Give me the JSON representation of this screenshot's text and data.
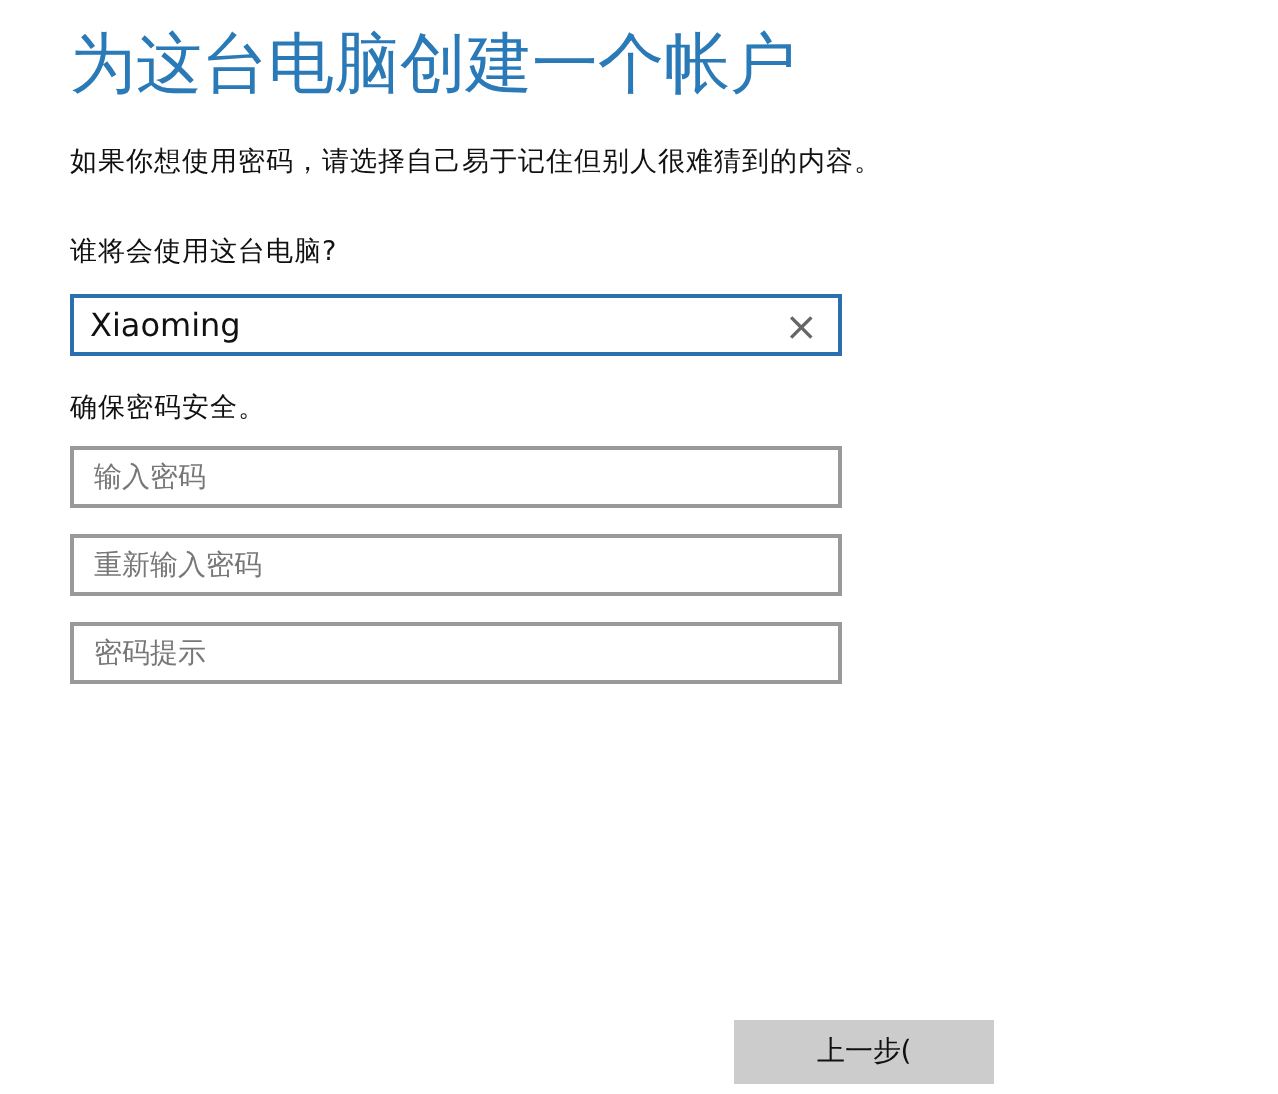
{
  "title": "为这台电脑创建一个帐户",
  "intro": "如果你想使用密码，请选择自己易于记住但别人很难猜到的内容。",
  "user_section": {
    "label": "谁将会使用这台电脑?",
    "field": {
      "value": "Xiaoming",
      "focused": true,
      "clear_button": "×"
    }
  },
  "password_section": {
    "label": "确保密码安全。",
    "fields": [
      {
        "placeholder": "输入密码"
      },
      {
        "placeholder": "重新输入密码"
      },
      {
        "placeholder": "密码提示"
      }
    ]
  },
  "buttons": [
    {
      "label": "上一步("
    }
  ]
}
